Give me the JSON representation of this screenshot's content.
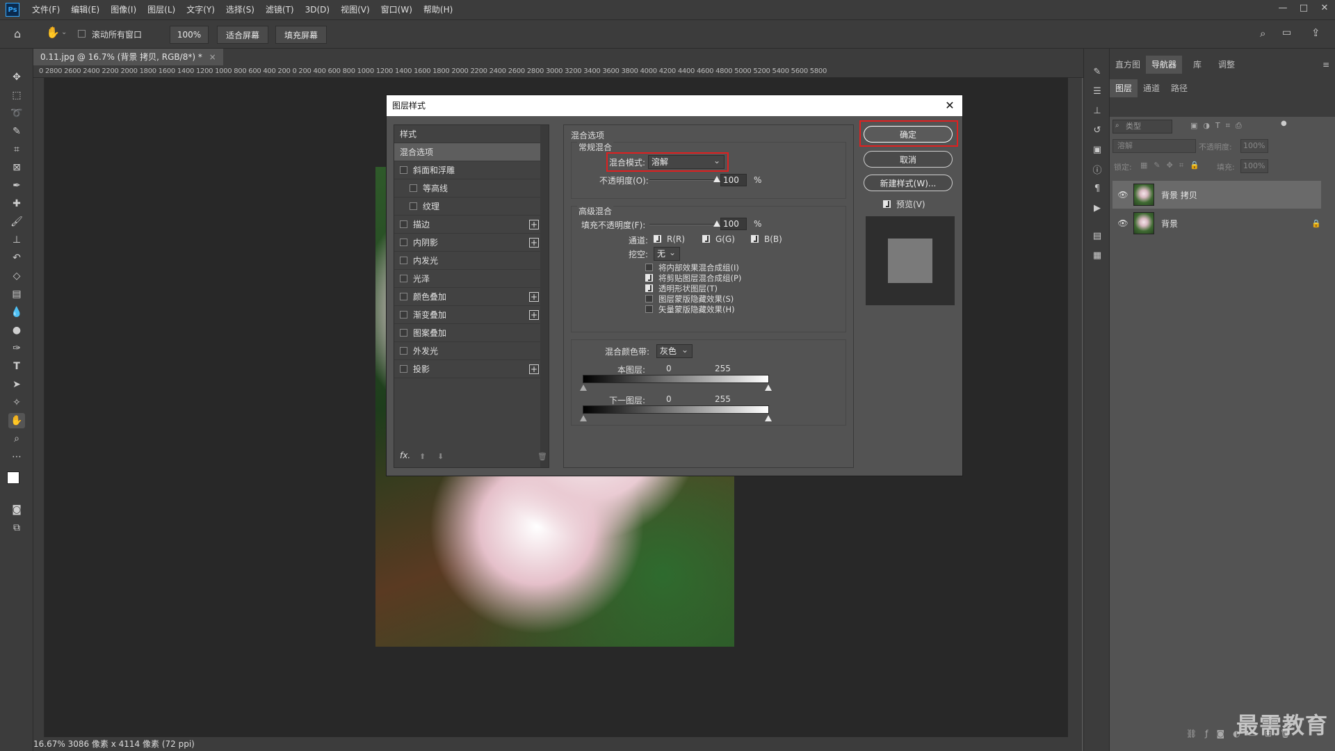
{
  "menubar": {
    "logo": "Ps",
    "items": [
      "文件(F)",
      "编辑(E)",
      "图像(I)",
      "图层(L)",
      "文字(Y)",
      "选择(S)",
      "滤镜(T)",
      "3D(D)",
      "视图(V)",
      "窗口(W)",
      "帮助(H)"
    ]
  },
  "optbar": {
    "scroll_all_label": "滚动所有窗口",
    "zoom_value": "100%",
    "fit_screen": "适合屏幕",
    "fill_screen": "填充屏幕"
  },
  "document": {
    "tab_title": "0.11.jpg @ 16.7% (背景 拷贝, RGB/8*) *",
    "ruler_ticks": "0 2800 2600 2400 2200 2000 1800 1600 1400 1200 1000 800 600 400 200 0 200 400 600 800 1000 1200 1400 1600 1800 2000 2200 2400 2600 2800 3000 3200 3400 3600 3800 4000 4200 4400 4600 4800 5000 5200 5400 5600 5800",
    "status": "16.67%  3086 像素 x 4114 像素 (72 ppi)"
  },
  "right_panel": {
    "top_tabs": [
      "直方图",
      "导航器",
      "库",
      "调整"
    ],
    "layer_tabs": [
      "图层",
      "通道",
      "路径"
    ],
    "filter_placeholder": "类型",
    "blend_value": "溶解",
    "opacity_label": "不透明度:",
    "opacity_value": "100%",
    "lock_label": "锁定:",
    "fill_label": "填充:",
    "fill_value": "100%",
    "layers": [
      {
        "name": "背景 拷贝"
      },
      {
        "name": "背景"
      }
    ]
  },
  "dialog": {
    "title": "图层样式",
    "styles_header": "样式",
    "styles": [
      {
        "label": "混合选项",
        "checkbox": false,
        "plus": false,
        "indent": false
      },
      {
        "label": "斜面和浮雕",
        "checkbox": true,
        "plus": false,
        "indent": false
      },
      {
        "label": "等高线",
        "checkbox": true,
        "plus": false,
        "indent": true
      },
      {
        "label": "纹理",
        "checkbox": true,
        "plus": false,
        "indent": true
      },
      {
        "label": "描边",
        "checkbox": true,
        "plus": true,
        "indent": false
      },
      {
        "label": "内阴影",
        "checkbox": true,
        "plus": true,
        "indent": false
      },
      {
        "label": "内发光",
        "checkbox": true,
        "plus": false,
        "indent": false
      },
      {
        "label": "光泽",
        "checkbox": true,
        "plus": false,
        "indent": false
      },
      {
        "label": "颜色叠加",
        "checkbox": true,
        "plus": true,
        "indent": false
      },
      {
        "label": "渐变叠加",
        "checkbox": true,
        "plus": true,
        "indent": false
      },
      {
        "label": "图案叠加",
        "checkbox": true,
        "plus": false,
        "indent": false
      },
      {
        "label": "外发光",
        "checkbox": true,
        "plus": false,
        "indent": false
      },
      {
        "label": "投影",
        "checkbox": true,
        "plus": true,
        "indent": false
      }
    ],
    "fx_label": "fx.",
    "blend_options_title": "混合选项",
    "general_blend_title": "常规混合",
    "blend_mode_label": "混合模式:",
    "blend_mode_value": "溶解",
    "opacity_label": "不透明度(O):",
    "opacity_value": "100",
    "percent": "%",
    "advanced_title": "高级混合",
    "fill_opacity_label": "填充不透明度(F):",
    "fill_opacity_value": "100",
    "channels_label": "通道:",
    "channel_r": "R(R)",
    "channel_g": "G(G)",
    "channel_b": "B(B)",
    "knockout_label": "挖空:",
    "knockout_value": "无",
    "options": [
      {
        "label": "将内部效果混合成组(I)",
        "checked": false
      },
      {
        "label": "将剪贴图层混合成组(P)",
        "checked": true
      },
      {
        "label": "透明形状图层(T)",
        "checked": true
      },
      {
        "label": "图层蒙版隐藏效果(S)",
        "checked": false
      },
      {
        "label": "矢量蒙版隐藏效果(H)",
        "checked": false
      }
    ],
    "blend_if_label": "混合颜色带:",
    "blend_if_value": "灰色",
    "this_layer_label": "本图层:",
    "under_layer_label": "下一图层:",
    "range_min": "0",
    "range_max": "255",
    "ok_label": "确定",
    "cancel_label": "取消",
    "new_style_label": "新建样式(W)...",
    "preview_label": "预览(V)"
  },
  "watermark": "最需教育"
}
